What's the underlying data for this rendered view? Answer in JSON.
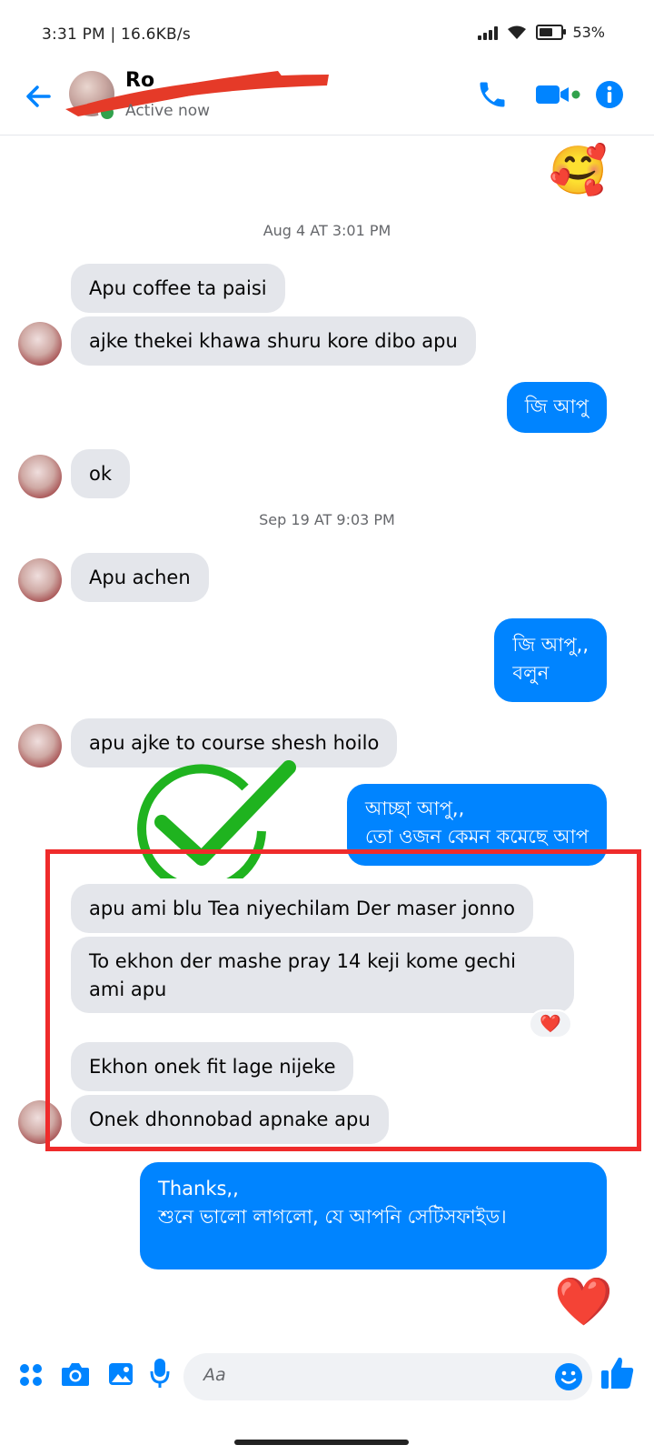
{
  "status_bar": {
    "time_speed": "3:31 PM | 16.6KB/s",
    "battery": "53%",
    "battery_level": 0.53
  },
  "header": {
    "name": "Ro",
    "presence": "Active now",
    "colors": {
      "accent": "#0084ff",
      "active": "#31a24c"
    }
  },
  "messages": {
    "ts1": "Aug 4 AT 3:01 PM",
    "m1": "Apu coffee ta paisi",
    "m2": "ajke thekei khawa shuru kore dibo apu",
    "m3": "জি আপু",
    "m4": "ok",
    "ts2": "Sep 19 AT 9:03 PM",
    "m5": "Apu achen",
    "m6": "জি আপু,,\nবলুন",
    "m7": "apu ajke to course shesh hoilo",
    "m8": "আচ্ছা আপু,,\nতো ওজন কেমন কমেছে আপ",
    "m9": "apu ami blu Tea niyechilam Der maser jonno",
    "m10": "To ekhon der mashe pray 14 keji kome gechi\nami apu",
    "m10_reaction": "❤️",
    "m11": "Ekhon onek fit lage nijeke",
    "m12": "Onek dhonnobad apnake apu",
    "m13": "Thanks,,\nশুনে ভালো লাগলো, যে আপনি সেটিসফাইড।",
    "top_emoji": "🥰",
    "bottom_emoji": "❤️"
  },
  "composer": {
    "placeholder": "Aa",
    "icons": [
      "menu-icon",
      "camera-icon",
      "gallery-icon",
      "mic-icon",
      "emoji-icon",
      "like-icon"
    ]
  }
}
